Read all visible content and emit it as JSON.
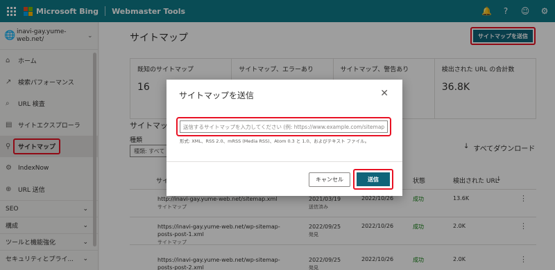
{
  "header": {
    "brand": "Microsoft Bing",
    "product": "Webmaster Tools",
    "icons": [
      "bell-icon",
      "help-icon",
      "smiley-icon",
      "gear-icon"
    ],
    "icon_glyphs": [
      "🔔",
      "?",
      "☺",
      "⚙"
    ],
    "color": "#0f7b8a"
  },
  "sidebar": {
    "site": "inavi-gay.yume-web.net/",
    "items": [
      {
        "label": "ホーム",
        "icon": "⌂"
      },
      {
        "label": "検索パフォーマンス",
        "icon": "↗"
      },
      {
        "label": "URL 検査",
        "icon": "⌕"
      },
      {
        "label": "サイトエクスプローラ",
        "icon": "▤"
      },
      {
        "label": "サイトマップ",
        "icon": "⚲"
      },
      {
        "label": "IndexNow",
        "icon": "⚙"
      },
      {
        "label": "URL 送信",
        "icon": "⊕"
      }
    ],
    "groups": [
      "SEO",
      "構成",
      "ツールと機能強化",
      "セキュリティとプライ..."
    ]
  },
  "main": {
    "title": "サイトマップ",
    "submit_button": "サイトマップを送信",
    "stats": [
      {
        "label": "既知のサイトマップ",
        "value": "16"
      },
      {
        "label": "サイトマップ、エラーあり",
        "value": ""
      },
      {
        "label": "サイトマップ、警告あり",
        "value": ""
      },
      {
        "label": "検出された URL の合計数",
        "value": "36.8K"
      }
    ],
    "section_title": "サイトマップ",
    "filter_label": "種類",
    "filter_value": "種類: すべて",
    "download": "すべてダウンロード",
    "columns": {
      "c1": "サイト",
      "status": "状態",
      "urls": "検出された URL"
    },
    "rows": [
      {
        "url": "http://inavi-gay.yume-web.net/sitemap.xml",
        "type": "サイトマップ",
        "d1": "2021/03/19",
        "d1sub": "送信済み",
        "d2": "2022/10/26",
        "status": "成功",
        "count": "13.6K"
      },
      {
        "url": "https://inavi-gay.yume-web.net/wp-sitemap-posts-post-1.xml",
        "type": "サイトマップ",
        "d1": "2022/09/25",
        "d1sub": "発見",
        "d2": "2022/10/26",
        "status": "成功",
        "count": "2.0K"
      },
      {
        "url": "https://inavi-gay.yume-web.net/wp-sitemap-posts-post-2.xml",
        "type": "",
        "d1": "2022/09/25",
        "d1sub": "発見",
        "d2": "2022/10/26",
        "status": "成功",
        "count": "2.0K"
      }
    ]
  },
  "modal": {
    "title": "サイトマップを送信",
    "input_placeholder": "送信するサイトマップを入力してください (例: https://www.example.com/sitemap.x...",
    "hint": "形式: XML、RSS 2.0、mRSS (Media RSS)、Atom 0.3 と 1.0、およびテキスト ファイル。",
    "cancel": "キャンセル",
    "send": "送信"
  }
}
